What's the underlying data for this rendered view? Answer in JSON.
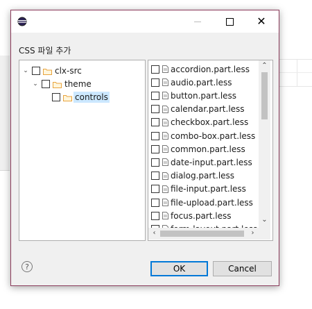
{
  "dialog": {
    "title": "CSS 파일 추가",
    "window_controls": {
      "minimize": "—",
      "maximize": "□",
      "close": "✕"
    },
    "app_icon": "eclipse-icon"
  },
  "tree": [
    {
      "label": "clx-src",
      "expanded": true,
      "checked": false,
      "selected": false
    },
    {
      "label": "theme",
      "expanded": true,
      "checked": false,
      "selected": false
    },
    {
      "label": "controls",
      "expanded": false,
      "checked": false,
      "selected": true
    }
  ],
  "files": [
    "accordion.part.less",
    "audio.part.less",
    "button.part.less",
    "calendar.part.less",
    "checkbox.part.less",
    "combo-box.part.less",
    "common.part.less",
    "date-input.part.less",
    "dialog.part.less",
    "file-input.part.less",
    "file-upload.part.less",
    "focus.part.less",
    "form-layout.part.less"
  ],
  "buttons": {
    "ok": "OK",
    "cancel": "Cancel",
    "help": "?"
  },
  "colors": {
    "selection": "#cce8ff",
    "focus_border": "#0078d7",
    "folder": "#e8a33d"
  }
}
